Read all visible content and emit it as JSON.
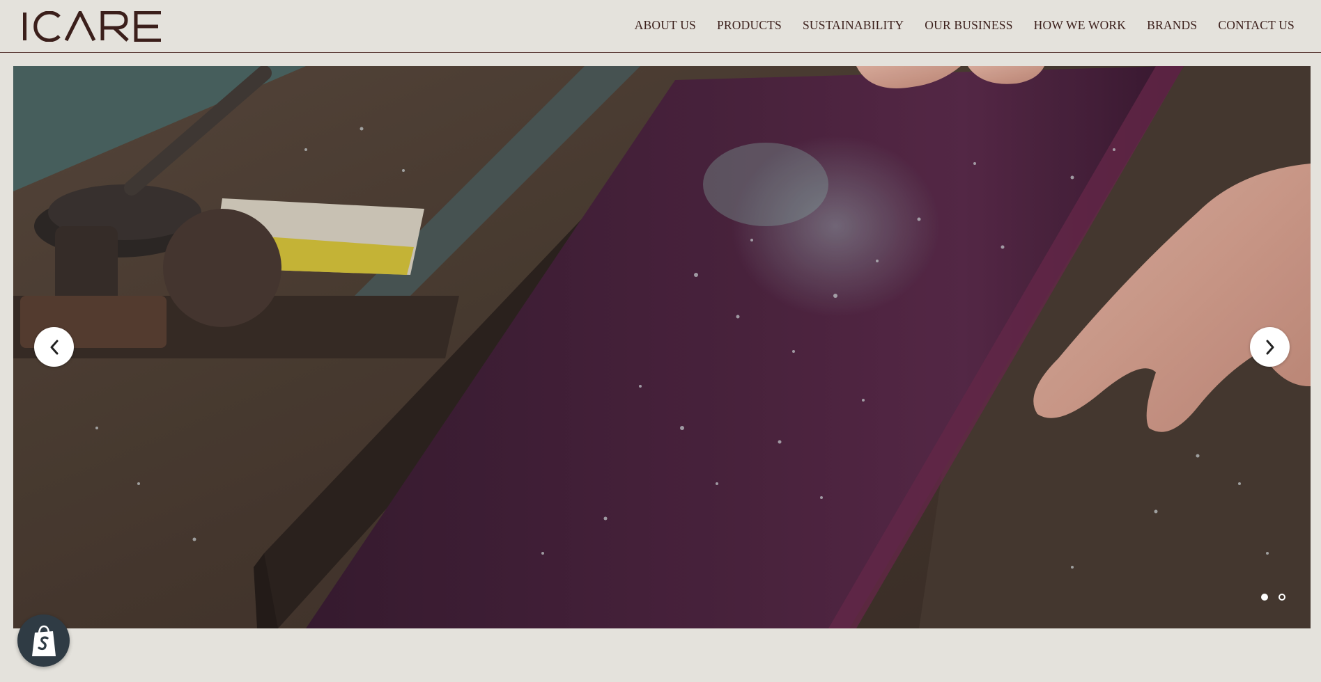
{
  "brand": {
    "logo_text": "ICARE",
    "logo_color": "#3b1f1b"
  },
  "nav": {
    "items": [
      {
        "label": "ABOUT US"
      },
      {
        "label": "PRODUCTS"
      },
      {
        "label": "SUSTAINABILITY"
      },
      {
        "label": "OUR BUSINESS"
      },
      {
        "label": "HOW WE WORK"
      },
      {
        "label": "BRANDS"
      },
      {
        "label": "CONTACT US"
      }
    ]
  },
  "hero": {
    "slide_count": 2,
    "active_slide": 1,
    "prev_icon": "chevron-left-icon",
    "next_icon": "chevron-right-icon"
  },
  "shop_badge": {
    "icon": "shopify-bag-icon",
    "color": "#2f3b44"
  },
  "colors": {
    "page_background": "#e4e2dc",
    "text": "#3b1f1b"
  }
}
